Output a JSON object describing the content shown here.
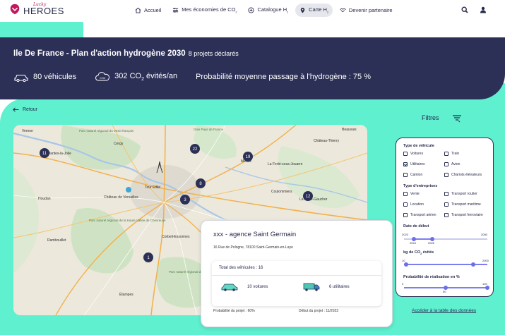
{
  "nav": {
    "logo_script": "Lucky",
    "logo_word": "HEROES",
    "items": [
      {
        "label": "Accueil",
        "icon": "home-icon"
      },
      {
        "label": "Mes économies de CO",
        "sub": "2",
        "icon": "sliders-icon"
      },
      {
        "label": "Catalogue H",
        "sub": "2",
        "icon": "plus-circle-icon"
      },
      {
        "label": "Carte H",
        "sub": "2",
        "icon": "map-pin-icon",
        "active": true
      },
      {
        "label": "Devenir partenaire",
        "icon": "handshake-icon"
      }
    ]
  },
  "header": {
    "title": "Ile De France - Plan d'action hydrogène 2030",
    "projects": "8 projets déclarés",
    "stat_vehicles": "80 véhicules",
    "stat_co2_prefix": "302 CO",
    "stat_co2_sub": "2",
    "stat_co2_suffix": " évités/an",
    "stat_prob": "Probabilité moyenne passage à l'hydrogène : 75 %"
  },
  "back_label": "Retour",
  "filters_label": "Filtres",
  "map": {
    "labels": [
      "Vernon",
      "Mantes-la-Jolie",
      "Cergy",
      "Tour Eiffel",
      "Château de Versailles",
      "Meaux",
      "La Ferté-sous-Jouarre",
      "Coulommiers",
      "Houdan",
      "Rambouillet",
      "Étampes",
      "Château-Thierry",
      "Parc naturel régional du Vexin français",
      "Parc naturel régional de la Haute Vallée de Chevreuse",
      "Parc naturel régional du Gâtinais français",
      "Corbeil-Essonnes",
      "La Ferté-Gaucher",
      "Oise Pays de France",
      "Beauvais"
    ],
    "markers": [
      {
        "count": "11"
      },
      {
        "count": "22"
      },
      {
        "count": "19"
      },
      {
        "count": "8"
      },
      {
        "count": "3"
      },
      {
        "count": "12"
      },
      {
        "count": "1"
      }
    ]
  },
  "card": {
    "title": "xxx - agence Saint Germain",
    "address": "16 Rue de Pologne, 78100 Saint-Germain-en-Laye",
    "total": "Total des véhicules : 16",
    "cars": "10 voitures",
    "vans": "6 utilitaires",
    "probability": "Probabilité du projet : 60%",
    "start": "Début du projet : 11/2023"
  },
  "panel": {
    "vehicle_type_title": "Type de véhicule",
    "vehicle_types": [
      {
        "label": "Voitures",
        "checked": false
      },
      {
        "label": "Train",
        "checked": false
      },
      {
        "label": "Utilitaires",
        "checked": true
      },
      {
        "label": "Avion",
        "checked": false
      },
      {
        "label": "Camion",
        "checked": false
      },
      {
        "label": "Chariots élévateurs",
        "checked": false
      }
    ],
    "company_type_title": "Type d'entreprises",
    "company_types": [
      {
        "label": "Vente",
        "checked": false
      },
      {
        "label": "Transport routier",
        "checked": false
      },
      {
        "label": "Location",
        "checked": false
      },
      {
        "label": "Transport maritime",
        "checked": false
      },
      {
        "label": "Transport aérien",
        "checked": false
      },
      {
        "label": "Transport ferroviaire",
        "checked": false
      }
    ],
    "start_date_title": "Date de début",
    "start_date": {
      "min": "2023",
      "max": "2050",
      "selected_min": "2024",
      "selected_max": "2026"
    },
    "co2_title_prefix": "kg de CO",
    "co2_title_sub": "2",
    "co2_title_suffix": " évités",
    "co2": {
      "min": "10",
      "max": "2000"
    },
    "prob_title": "Probabilité de réalisation en %",
    "prob": {
      "min": "0",
      "mid": "50",
      "max": "100"
    }
  },
  "data_link": "Accéder à la table des données",
  "colors": {
    "mint": "#5ef0cf",
    "navy": "#2c3056",
    "accent": "#6d6fe8"
  }
}
